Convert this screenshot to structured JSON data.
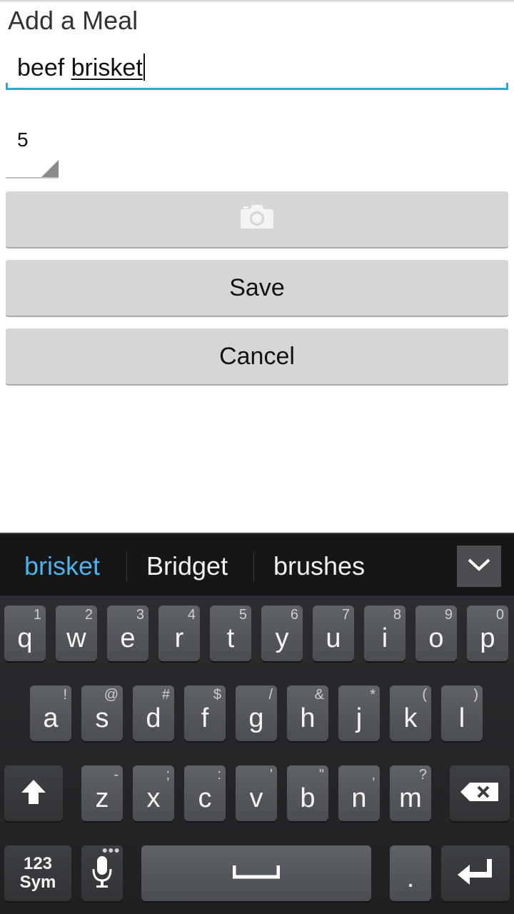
{
  "header": {
    "title": "Add a Meal"
  },
  "form": {
    "name_prefix": "beef ",
    "name_highlighted": "brisket",
    "quantity": "5",
    "save_label": "Save",
    "cancel_label": "Cancel",
    "camera_icon": "camera-icon"
  },
  "keyboard": {
    "suggestions": [
      "brisket",
      "Bridget",
      "brushes"
    ],
    "row1": [
      {
        "k": "q",
        "h": "1"
      },
      {
        "k": "w",
        "h": "2"
      },
      {
        "k": "e",
        "h": "3"
      },
      {
        "k": "r",
        "h": "4"
      },
      {
        "k": "t",
        "h": "5"
      },
      {
        "k": "y",
        "h": "6"
      },
      {
        "k": "u",
        "h": "7"
      },
      {
        "k": "i",
        "h": "8"
      },
      {
        "k": "o",
        "h": "9"
      },
      {
        "k": "p",
        "h": "0"
      }
    ],
    "row2": [
      {
        "k": "a",
        "h": "!"
      },
      {
        "k": "s",
        "h": "@"
      },
      {
        "k": "d",
        "h": "#"
      },
      {
        "k": "f",
        "h": "$"
      },
      {
        "k": "g",
        "h": "/"
      },
      {
        "k": "h",
        "h": "&"
      },
      {
        "k": "j",
        "h": "*"
      },
      {
        "k": "k",
        "h": "("
      },
      {
        "k": "l",
        "h": ")"
      }
    ],
    "row3": [
      {
        "k": "z",
        "h": "-"
      },
      {
        "k": "x",
        "h": ";"
      },
      {
        "k": "c",
        "h": ":"
      },
      {
        "k": "v",
        "h": "'"
      },
      {
        "k": "b",
        "h": "\""
      },
      {
        "k": "n",
        "h": ","
      },
      {
        "k": "m",
        "h": "?"
      }
    ],
    "sym_top": "123",
    "sym_bottom": "Sym",
    "period": ".",
    "icons": {
      "shift": "shift-icon",
      "backspace": "backspace-icon",
      "mic": "microphone-icon",
      "space": "space-icon",
      "enter": "enter-icon",
      "collapse": "chevron-down-icon"
    }
  }
}
